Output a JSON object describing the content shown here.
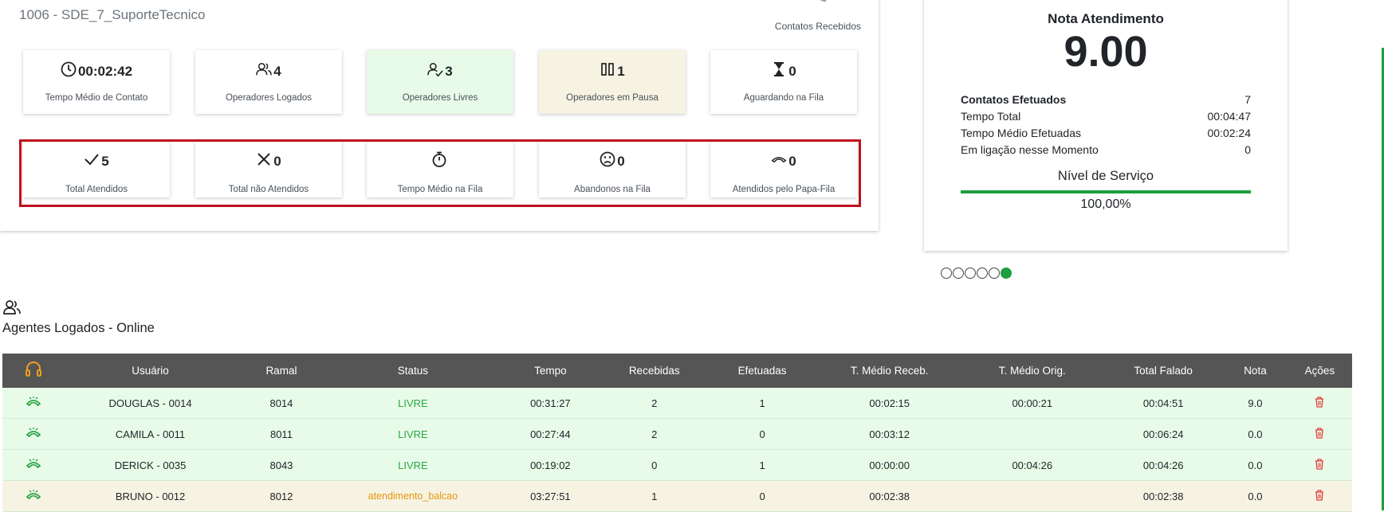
{
  "queue": {
    "name": "1006 - SDE_7_SuporteTecnico",
    "received_label": "Contatos Recebidos"
  },
  "stats_top": [
    {
      "icon": "clock-icon",
      "value": "00:02:42",
      "label": "Tempo Médio de Contato"
    },
    {
      "icon": "users-icon",
      "value": "4",
      "label": "Operadores Logados"
    },
    {
      "icon": "user-check-icon",
      "value": "3",
      "label": "Operadores Livres"
    },
    {
      "icon": "pause-icon",
      "value": "1",
      "label": "Operadores em Pausa"
    },
    {
      "icon": "hourglass-icon",
      "value": "0",
      "label": "Aguardando na Fila"
    }
  ],
  "stats_bottom": [
    {
      "icon": "check-icon",
      "value": "5",
      "label": "Total Atendidos"
    },
    {
      "icon": "x-icon",
      "value": "0",
      "label": "Total não Atendidos"
    },
    {
      "icon": "stopwatch-icon",
      "value": "",
      "label": "Tempo Médio na Fila"
    },
    {
      "icon": "sad-face-icon",
      "value": "0",
      "label": "Abandonos na Fila"
    },
    {
      "icon": "phone-hangup-icon",
      "value": "0",
      "label": "Atendidos pelo Papa-Fila"
    }
  ],
  "rating": {
    "title": "Nota Atendimento",
    "score": "9.00",
    "rows": [
      {
        "label": "Contatos Efetuados",
        "value": "7"
      },
      {
        "label": "Tempo Total",
        "value": "00:04:47"
      },
      {
        "label": "Tempo Médio Efetuadas",
        "value": "00:02:24"
      },
      {
        "label": "Em ligação nesse Momento",
        "value": "0"
      }
    ],
    "service_level_label": "Nível de Serviço",
    "service_level": "100,00%",
    "service_level_fraction": 1.0
  },
  "carousel": {
    "count": 6,
    "active": 5
  },
  "agents": {
    "title": "Agentes Logados - Online",
    "columns": [
      "Usuário",
      "Ramal",
      "Status",
      "Tempo",
      "Recebidas",
      "Efetuadas",
      "T. Médio Receb.",
      "T. Médio Orig.",
      "Total Falado",
      "Nota",
      "Ações"
    ],
    "rows": [
      {
        "user": "DOUGLAS - 0014",
        "ext": "8014",
        "status": "LIVRE",
        "time": "00:31:27",
        "received": "2",
        "made": "1",
        "avg_recv": "00:02:15",
        "avg_orig": "00:00:21",
        "total": "00:04:51",
        "score": "9.0"
      },
      {
        "user": "CAMILA - 0011",
        "ext": "8011",
        "status": "LIVRE",
        "time": "00:27:44",
        "received": "2",
        "made": "0",
        "avg_recv": "00:03:12",
        "avg_orig": "",
        "total": "00:06:24",
        "score": "0.0"
      },
      {
        "user": "DERICK - 0035",
        "ext": "8043",
        "status": "LIVRE",
        "time": "00:19:02",
        "received": "0",
        "made": "1",
        "avg_recv": "00:00:00",
        "avg_orig": "00:04:26",
        "total": "00:04:26",
        "score": "0.0"
      },
      {
        "user": "BRUNO - 0012",
        "ext": "8012",
        "status": "atendimento_balcao",
        "time": "03:27:51",
        "received": "1",
        "made": "0",
        "avg_recv": "00:02:38",
        "avg_orig": "",
        "total": "00:02:38",
        "score": "0.0"
      }
    ]
  },
  "colors": {
    "accent_green": "#1e9e3e",
    "header_dark": "#555555",
    "highlight_red": "#c0101e",
    "status_orange": "#e8960c"
  }
}
